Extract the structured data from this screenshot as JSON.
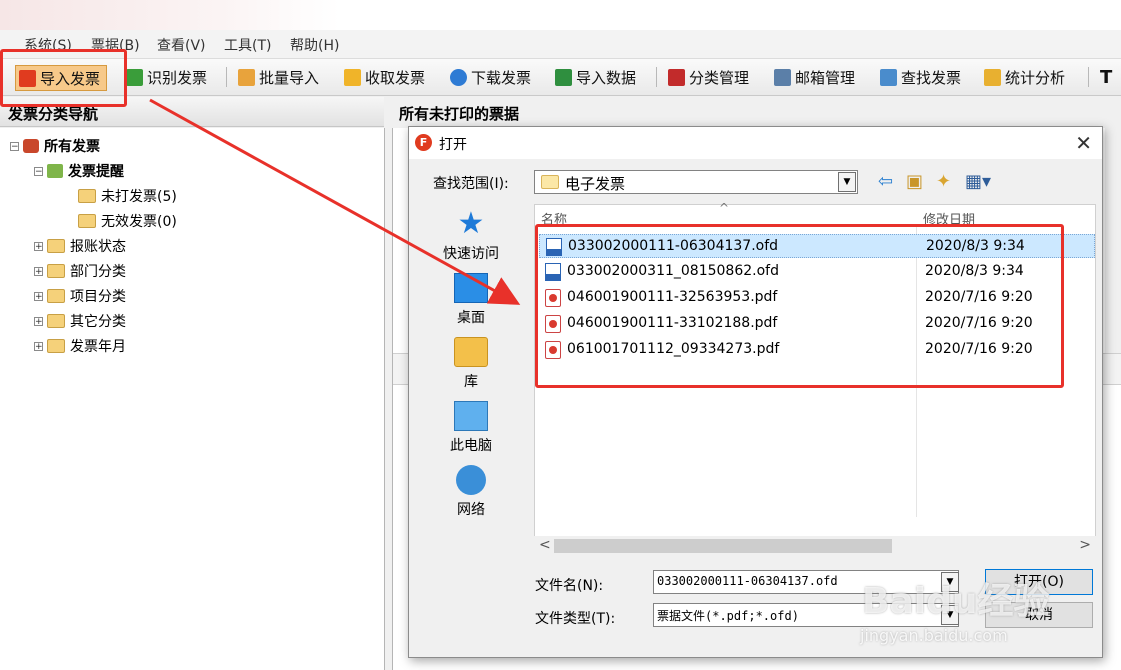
{
  "menubar": {
    "items": [
      "系统(S)",
      "票据(B)",
      "查看(V)",
      "工具(T)",
      "帮助(H)"
    ]
  },
  "toolbar": {
    "items": [
      "导入发票",
      "识别发票",
      "批量导入",
      "收取发票",
      "下载发票",
      "导入数据",
      "分类管理",
      "邮箱管理",
      "查找发票",
      "统计分析"
    ]
  },
  "nav": {
    "title": "发票分类导航",
    "root": "所有发票",
    "reminder": "发票提醒",
    "unprinted": "未打发票(5)",
    "invalid": "无效发票(0)",
    "groups": [
      "报账状态",
      "部门分类",
      "项目分类",
      "其它分类",
      "发票年月"
    ]
  },
  "right": {
    "title": "所有未打印的票据"
  },
  "dialog": {
    "title": "打开",
    "lookin_label": "查找范围(I):",
    "lookin_value": "电子发票",
    "places": [
      "快速访问",
      "桌面",
      "库",
      "此电脑",
      "网络"
    ],
    "columns": {
      "name": "名称",
      "date": "修改日期"
    },
    "files": [
      {
        "name": "033002000111-06304137.ofd",
        "date": "2020/8/3 9:34",
        "type": "ofd"
      },
      {
        "name": "033002000311_08150862.ofd",
        "date": "2020/8/3 9:34",
        "type": "ofd"
      },
      {
        "name": "046001900111-32563953.pdf",
        "date": "2020/7/16 9:20",
        "type": "pdf"
      },
      {
        "name": "046001900111-33102188.pdf",
        "date": "2020/7/16 9:20",
        "type": "pdf"
      },
      {
        "name": "061001701112_09334273.pdf",
        "date": "2020/7/16 9:20",
        "type": "pdf"
      }
    ],
    "filename_label": "文件名(N):",
    "filename_value": "033002000111-06304137.ofd",
    "filetype_label": "文件类型(T):",
    "filetype_value": "票据文件(*.pdf;*.ofd)",
    "open_button": "打开(O)",
    "cancel_button": "取消"
  },
  "watermark": {
    "brand": "Baidu经验",
    "url": "jingyan.baidu.com"
  },
  "colors": {
    "annotation_red": "#e8312a",
    "selected_row": "#cce8ff"
  }
}
